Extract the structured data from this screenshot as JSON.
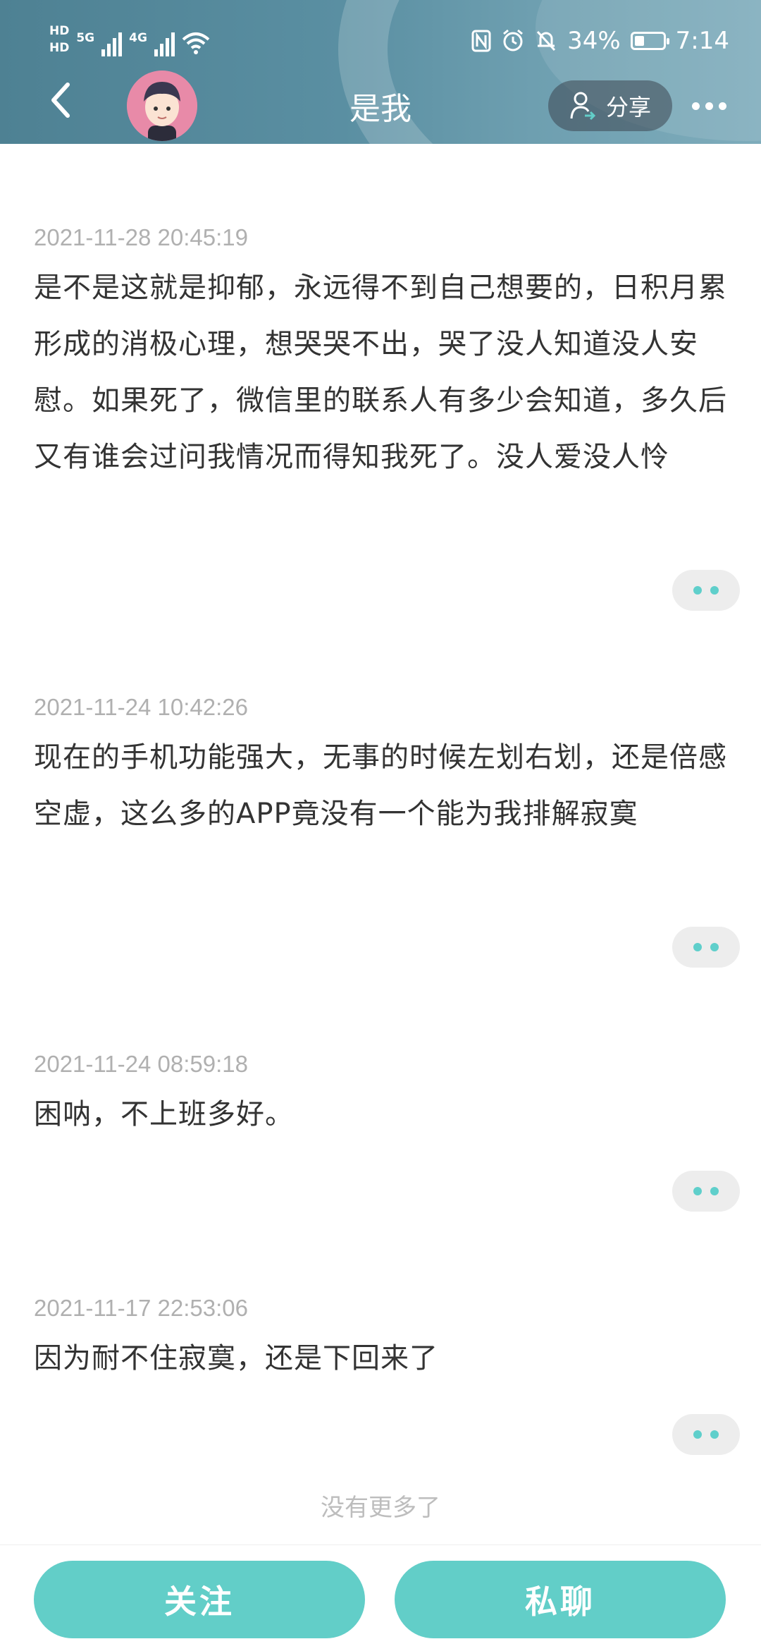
{
  "status": {
    "hd1": "HD",
    "hd2": "HD",
    "net1": "5G",
    "net2": "4G",
    "battery_pct": "34%",
    "battery_level": 0.34,
    "time": "7:14"
  },
  "header": {
    "title": "是我",
    "share_label": "分享"
  },
  "posts": [
    {
      "time": "2021-11-28 20:45:19",
      "text": "是不是这就是抑郁，永远得不到自己想要的，日积月累形成的消极心理，想哭哭不出，哭了没人知道没人安慰。如果死了，微信里的联系人有多少会知道，多久后又有谁会过问我情况而得知我死了。没人爱没人怜"
    },
    {
      "time": "2021-11-24 10:42:26",
      "text": "现在的手机功能强大，无事的时候左划右划，还是倍感空虚，这么多的APP竟没有一个能为我排解寂寞"
    },
    {
      "time": "2021-11-24 08:59:18",
      "text": "困呐，不上班多好。"
    },
    {
      "time": "2021-11-17 22:53:06",
      "text": "因为耐不住寂寞，还是下回来了"
    }
  ],
  "footer": {
    "no_more": "没有更多了",
    "follow_label": "关注",
    "chat_label": "私聊"
  },
  "colors": {
    "accent": "#62cec8",
    "header": "#5a8fa2"
  }
}
